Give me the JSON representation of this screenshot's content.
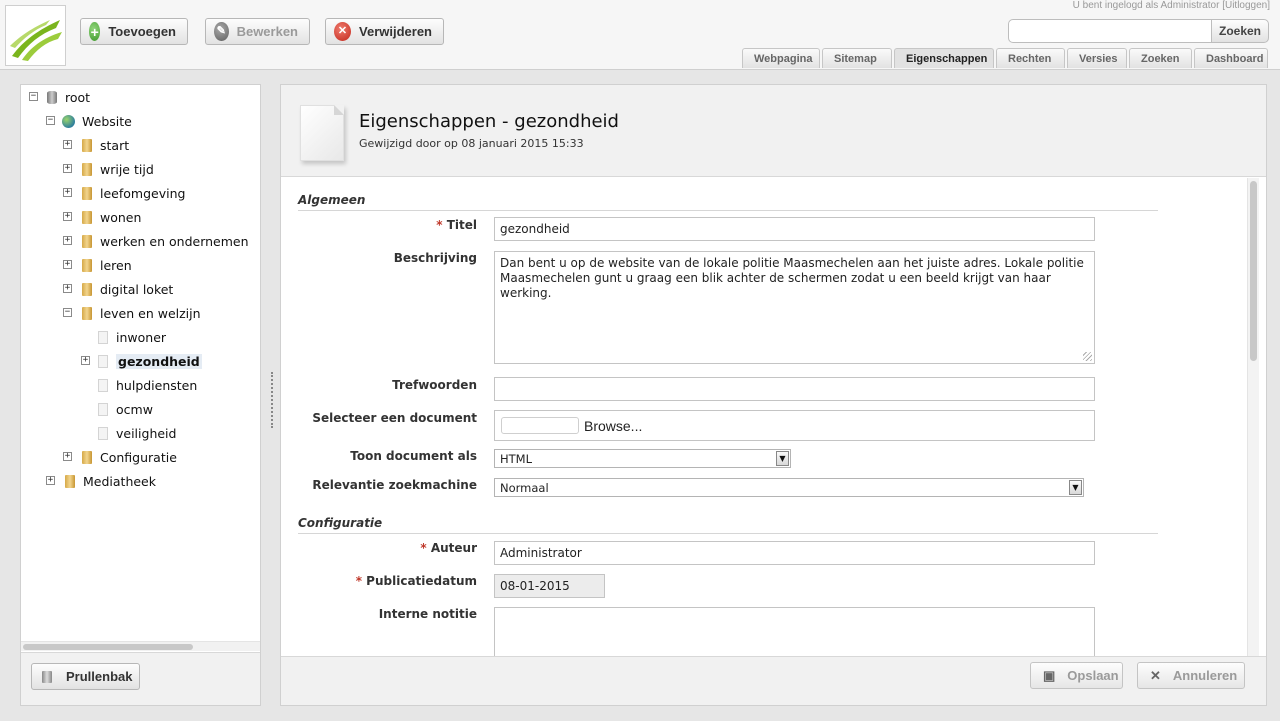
{
  "toolbar": {
    "add_label": "Toevoegen",
    "edit_label": "Bewerken",
    "delete_label": "Verwijderen"
  },
  "header": {
    "login_text": "U bent ingelogd als Administrator",
    "logout_label": "[Uitloggen]",
    "search_placeholder": "",
    "search_button": "Zoeken",
    "tabs": [
      "Webpagina",
      "Sitemap",
      "Eigenschappen",
      "Rechten",
      "Versies",
      "Zoeken",
      "Dashboard"
    ],
    "active_tab": "Eigenschappen"
  },
  "tree": {
    "nodes": [
      {
        "label": "root",
        "icon": "database-icon",
        "toggle": "−"
      },
      {
        "label": "Website",
        "icon": "globe-icon",
        "toggle": "−"
      },
      {
        "label": "start",
        "icon": "folder-icon",
        "toggle": "+"
      },
      {
        "label": "wrije tijd",
        "icon": "folder-icon",
        "toggle": "+"
      },
      {
        "label": "leefomgeving",
        "icon": "folder-icon",
        "toggle": "+"
      },
      {
        "label": "wonen",
        "icon": "folder-icon",
        "toggle": "+"
      },
      {
        "label": "werken en ondernemen",
        "icon": "folder-icon",
        "toggle": "+"
      },
      {
        "label": "leren",
        "icon": "folder-icon",
        "toggle": "+"
      },
      {
        "label": "digital loket",
        "icon": "folder-icon",
        "toggle": "+"
      },
      {
        "label": "leven en welzijn",
        "icon": "folder-icon",
        "toggle": "−"
      },
      {
        "label": "inwoner",
        "icon": "page-icon",
        "toggle": ""
      },
      {
        "label": "gezondheid",
        "icon": "page-icon",
        "toggle": "+",
        "selected": true
      },
      {
        "label": "hulpdiensten",
        "icon": "page-icon",
        "toggle": ""
      },
      {
        "label": "ocmw",
        "icon": "page-icon",
        "toggle": ""
      },
      {
        "label": "veiligheid",
        "icon": "page-icon",
        "toggle": ""
      },
      {
        "label": "Configuratie",
        "icon": "folder-icon",
        "toggle": "+"
      },
      {
        "label": "Mediatheek",
        "icon": "folder-icon",
        "toggle": "+"
      }
    ],
    "trash_label": "Prullenbak"
  },
  "page": {
    "title": "Eigenschappen - gezondheid",
    "subtitle": "Gewijzigd door  op  08 januari 2015 15:33"
  },
  "form": {
    "section_general": "Algemeen",
    "title_label": "Titel",
    "title_value": "gezondheid",
    "description_label": "Beschrijving",
    "description_value": "Dan bent u op de website van de lokale politie Maasmechelen aan het juiste adres. Lokale politie Maasmechelen gunt u graag een blik achter de schermen zodat u een beeld krijgt van haar werking.",
    "keywords_label": "Trefwoorden",
    "keywords_value": "",
    "document_label": "Selecteer een document",
    "browse_label": "Browse...",
    "show_as_label": "Toon document als",
    "show_as_value": "HTML",
    "relevance_label": "Relevantie zoekmachine",
    "relevance_value": "Normaal",
    "section_config": "Configuratie",
    "author_label": "Auteur",
    "author_value": "Administrator",
    "pubdate_label": "Publicatiedatum",
    "pubdate_value": "08-01-2015",
    "note_label": "Interne notitie",
    "note_value": "",
    "required_marker": "*"
  },
  "footer": {
    "save_label": "Opslaan",
    "cancel_label": "Annuleren"
  },
  "colors": {
    "brand": "#7ab51d",
    "required": "#c0392b"
  }
}
